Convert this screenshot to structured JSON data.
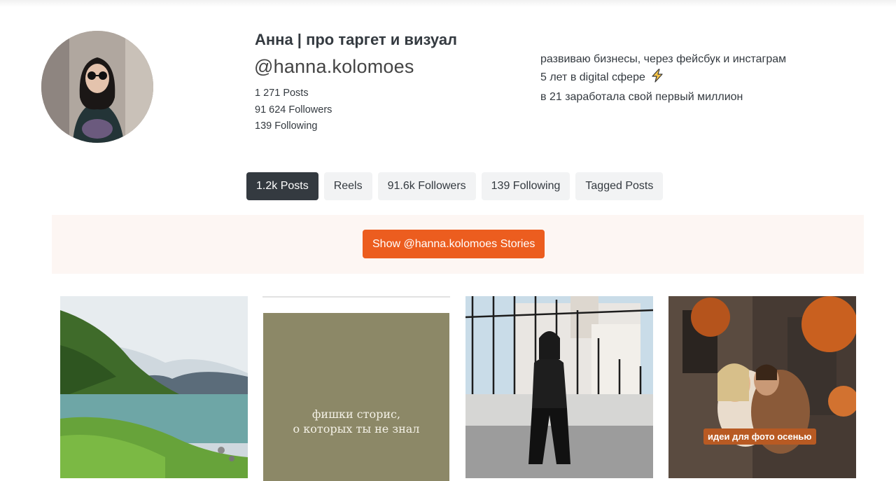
{
  "profile": {
    "name": "Анна | про таргет и визуал",
    "handle": "@hanna.kolomoes",
    "stats": {
      "posts": "1 271 Posts",
      "followers": "91 624 Followers",
      "following": "139 Following"
    },
    "bio": {
      "line1": "развиваю бизнесы, через фейсбук и инстаграм",
      "line2": "5 лет в digital сфере",
      "line3": "в 21 заработала свой первый миллион"
    }
  },
  "tabs": [
    {
      "label": "1.2k Posts",
      "active": true
    },
    {
      "label": "Reels",
      "active": false
    },
    {
      "label": "91.6k Followers",
      "active": false
    },
    {
      "label": "139 Following",
      "active": false
    },
    {
      "label": "Tagged Posts",
      "active": false
    }
  ],
  "stories": {
    "button_label": "Show @hanna.kolomoes Stories"
  },
  "posts": [
    {
      "kind": "photo-landscape"
    },
    {
      "kind": "text-card",
      "line1": "фишки сторис,",
      "line2": "о которых ты не знал"
    },
    {
      "kind": "photo-person"
    },
    {
      "kind": "photo-couple",
      "caption": "идеи для фото осенью"
    }
  ],
  "colors": {
    "accent": "#ec5d1f",
    "active_tab": "#343a40",
    "stories_band": "#fdf6f3",
    "text_card": "#8c8867",
    "bolt": "#f7c548"
  },
  "icons": {
    "bio_line2": "lightning-bolt-icon"
  }
}
